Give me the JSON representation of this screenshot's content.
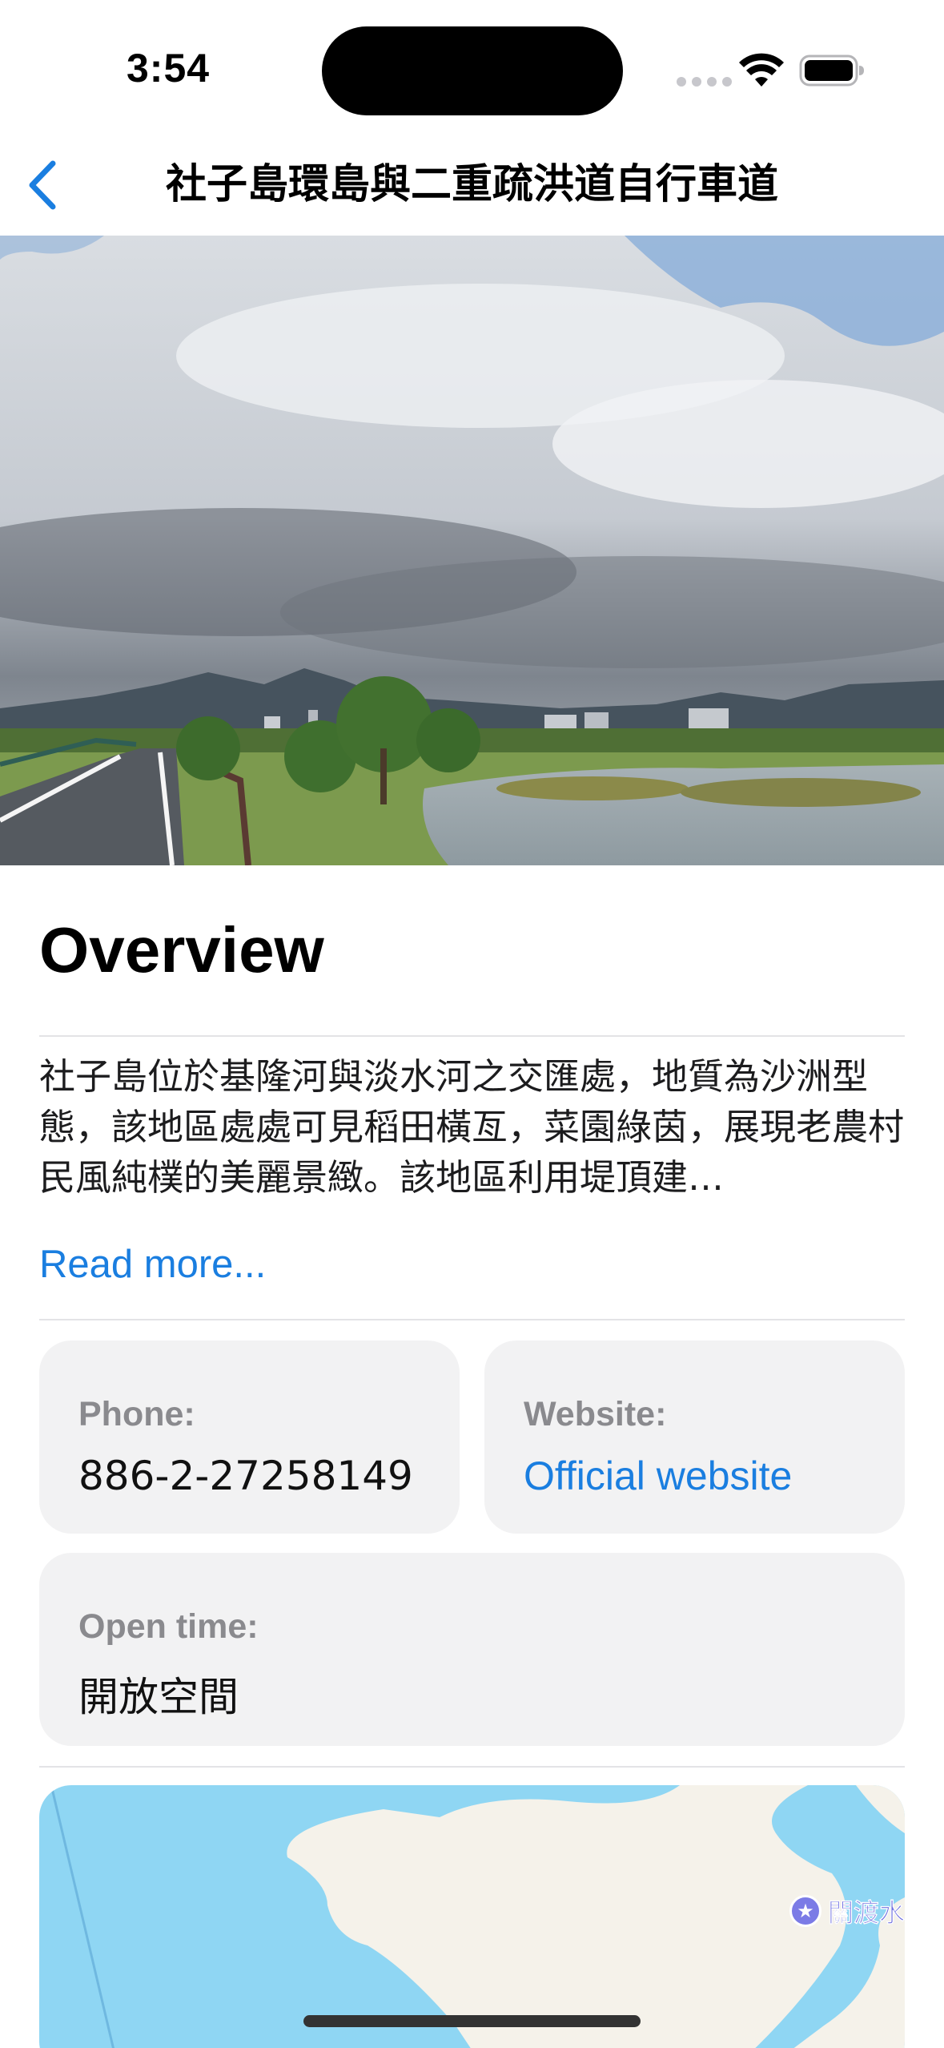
{
  "status_bar": {
    "time": "3:54",
    "wifi_icon": "wifi-icon",
    "battery_icon": "battery-icon"
  },
  "nav": {
    "back_icon": "chevron-left-icon",
    "title": "社子島環島與二重疏洪道自行車道"
  },
  "hero": {
    "description_icon": "hero-photo"
  },
  "overview": {
    "heading": "Overview",
    "text": "社子島位於基隆河與淡水河之交匯處，地質為沙洲型態，該地區處處可見稻田橫亙，菜園綠茵，展現老農村民風純樸的美麗景緻。該地區利用堤頂建…",
    "read_more": "Read more..."
  },
  "info": {
    "phone_label": "Phone:",
    "phone_value": "886-2-27258149",
    "website_label": "Website:",
    "website_value": "Official website",
    "open_time_label": "Open time:",
    "open_time_value": "開放空間"
  },
  "map": {
    "poi_label": "關渡水",
    "poi_icon": "star-icon"
  },
  "colors": {
    "accent": "#1a7ee0",
    "card_bg": "#f2f2f3",
    "label_gray": "#8a8a8e",
    "map_water": "#8fd6f3",
    "map_land": "#f5f2ea"
  }
}
